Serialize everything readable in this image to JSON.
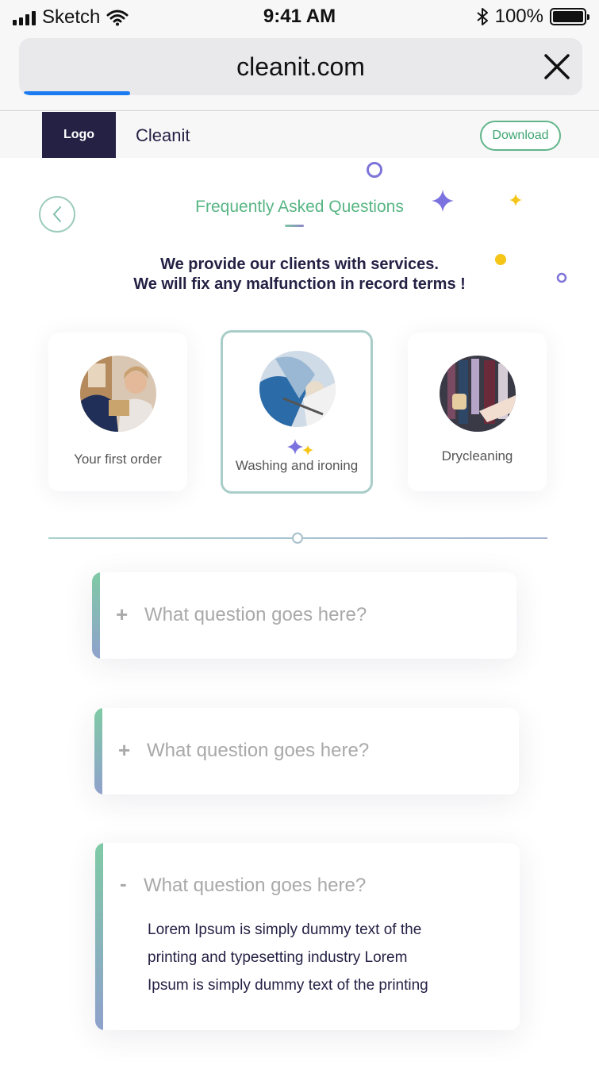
{
  "status_bar": {
    "carrier": "Sketch",
    "time": "9:41 AM",
    "battery": "100%"
  },
  "browser": {
    "url": "cleanit.com",
    "load_progress": 0.18
  },
  "nav": {
    "logo": "Logo",
    "brand": "Cleanit",
    "download": "Download"
  },
  "page": {
    "title": "Frequently Asked Questions",
    "subtitle_line1": "We provide our clients with services.",
    "subtitle_line2": "We will fix any malfunction in record terms !"
  },
  "categories": [
    {
      "label": "Your first order",
      "icon": "customer-photo",
      "active": false
    },
    {
      "label": "Washing and ironing",
      "icon": "washing-photo",
      "active": true
    },
    {
      "label": "Drycleaning",
      "icon": "drycleaning-photo",
      "active": false
    }
  ],
  "faq": [
    {
      "question": "What question goes here?",
      "expanded": false,
      "icon": "+"
    },
    {
      "question": "What question goes here?",
      "expanded": false,
      "icon": "+"
    },
    {
      "question": "What question goes here?",
      "expanded": true,
      "icon": "-",
      "answer_lines": [
        "Lorem Ipsum is simply dummy text of the",
        "printing and typesetting industry Lorem",
        "Ipsum is simply dummy text of the printing"
      ]
    }
  ],
  "colors": {
    "primary_dark": "#252145",
    "accent_green": "#58b584",
    "accent_purple": "#7b72e0",
    "accent_yellow": "#f5c518",
    "link_blue": "#1a7cf0"
  }
}
